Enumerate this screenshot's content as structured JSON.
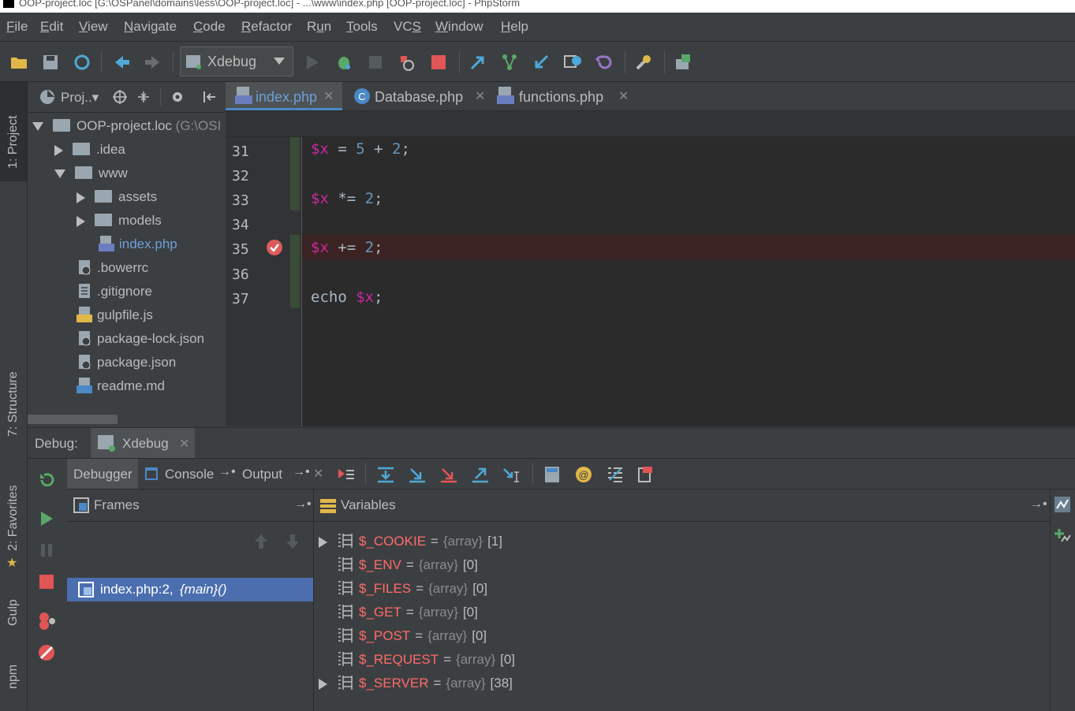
{
  "window": {
    "title": "OOP-project.loc [G:\\OSPanel\\domains\\less\\OOP-project.loc] - ...\\www\\index.php [OOP-project.loc] - PhpStorm"
  },
  "menu": [
    "File",
    "Edit",
    "View",
    "Navigate",
    "Code",
    "Refactor",
    "Run",
    "Tools",
    "VCS",
    "Window",
    "Help"
  ],
  "menu_mnemonics": [
    "F",
    "E",
    "V",
    "N",
    "C",
    "R",
    "u",
    "T",
    "S",
    "W",
    "H"
  ],
  "toolbar": {
    "run_config": "Xdebug"
  },
  "left_strip": {
    "project_tab": "1: Project",
    "structure_tab": "7: Structure",
    "favorites_tab": "2: Favorites",
    "gulp_tab": "Gulp",
    "npm_tab": "npm"
  },
  "project": {
    "header_label": "Proj..▾",
    "root": {
      "name": "OOP-project.loc",
      "path": "(G:\\OSI"
    },
    "items": [
      {
        "name": ".idea",
        "type": "folder",
        "level": 1,
        "state": "collapsed"
      },
      {
        "name": "www",
        "type": "folder",
        "level": 1,
        "state": "expanded"
      },
      {
        "name": "assets",
        "type": "folder",
        "level": 2,
        "state": "collapsed"
      },
      {
        "name": "models",
        "type": "folder",
        "level": 2,
        "state": "collapsed"
      },
      {
        "name": "index.php",
        "type": "php",
        "level": 2,
        "active": true
      },
      {
        "name": ".bowerrc",
        "type": "config",
        "level": 1
      },
      {
        "name": ".gitignore",
        "type": "text",
        "level": 1
      },
      {
        "name": "gulpfile.js",
        "type": "js",
        "level": 1
      },
      {
        "name": "package-lock.json",
        "type": "json",
        "level": 1
      },
      {
        "name": "package.json",
        "type": "json",
        "level": 1
      },
      {
        "name": "readme.md",
        "type": "md",
        "level": 1
      }
    ]
  },
  "editor": {
    "tabs": [
      {
        "label": "index.php",
        "active": true
      },
      {
        "label": "Database.php",
        "active": false
      },
      {
        "label": "functions.php",
        "active": false
      }
    ],
    "lines": [
      {
        "num": "31",
        "code": "$x = 5 + 2;"
      },
      {
        "num": "32",
        "code": ""
      },
      {
        "num": "33",
        "code": "$x *= 2;"
      },
      {
        "num": "34",
        "code": ""
      },
      {
        "num": "35",
        "code": "$x += 2;",
        "breakpoint": true
      },
      {
        "num": "36",
        "code": ""
      },
      {
        "num": "37",
        "code": "echo $x;"
      }
    ]
  },
  "debug": {
    "title_label": "Debug:",
    "session": "Xdebug",
    "tabs": [
      "Debugger",
      "Console",
      "Output"
    ],
    "frames_label": "Frames",
    "variables_label": "Variables",
    "frame_selected": "index.php:2, ",
    "frame_selected_fn": "{main}()",
    "variables": [
      {
        "name": "$_COOKIE",
        "type": "{array}",
        "count": "[1]",
        "expandable": true
      },
      {
        "name": "$_ENV",
        "type": "{array}",
        "count": "[0]",
        "expandable": false
      },
      {
        "name": "$_FILES",
        "type": "{array}",
        "count": "[0]",
        "expandable": false
      },
      {
        "name": "$_GET",
        "type": "{array}",
        "count": "[0]",
        "expandable": false
      },
      {
        "name": "$_POST",
        "type": "{array}",
        "count": "[0]",
        "expandable": false
      },
      {
        "name": "$_REQUEST",
        "type": "{array}",
        "count": "[0]",
        "expandable": false
      },
      {
        "name": "$_SERVER",
        "type": "{array}",
        "count": "[38]",
        "expandable": true
      }
    ]
  },
  "colors": {
    "accent": "#4b6eaf",
    "var": "#c828a0",
    "number": "#6897bb",
    "var_name": "#ff6b68",
    "breakpoint_line": "#3b2323"
  }
}
